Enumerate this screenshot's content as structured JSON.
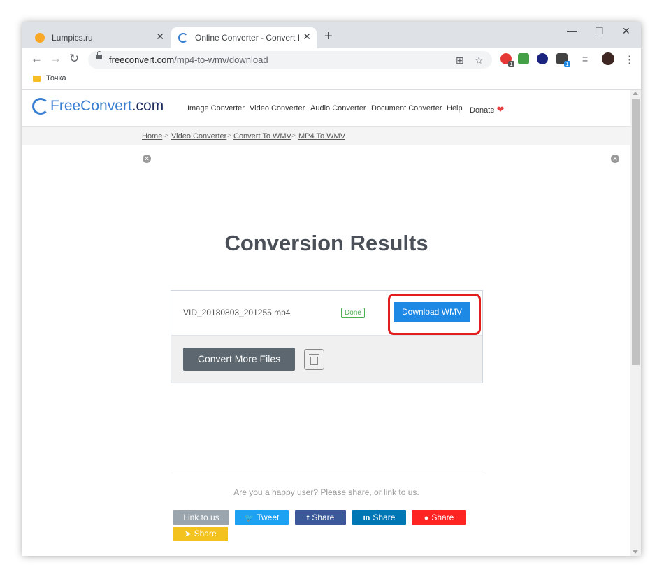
{
  "browser": {
    "tabs": [
      {
        "title": "Lumpics.ru",
        "favicon": "lumpics-favicon",
        "active": false
      },
      {
        "title": "Online Converter - Convert Imag",
        "favicon": "freeconvert-favicon",
        "active": true
      }
    ],
    "new_tab": "+",
    "window_controls": {
      "minimize": "—",
      "maximize": "☐",
      "close": "✕"
    },
    "url_host": "freeconvert.com",
    "url_path": "/mp4-to-wmv/download",
    "bookmark": "Точка"
  },
  "site": {
    "logo_text": "FreeConvert",
    "logo_suffix": ".com",
    "nav": [
      "Image Converter",
      "Video Converter",
      "Audio Converter",
      "Document Converter",
      "Help",
      "Donate"
    ],
    "breadcrumb": [
      "Home",
      "Video Converter",
      "Convert To WMV",
      "MP4 To WMV"
    ],
    "breadcrumb_sep": ">"
  },
  "main": {
    "heading": "Conversion Results",
    "file_name": "VID_20180803_201255.mp4",
    "status": "Done",
    "download_label": "Download WMV",
    "convert_more_label": "Convert More Files",
    "share_prompt": "Are you a happy user? Please share, or link to us."
  },
  "share_buttons": [
    {
      "label": "Link to us",
      "icon": "",
      "color": "#9aa5ad"
    },
    {
      "label": "Tweet",
      "icon": "twitter-icon",
      "color": "#1da1f2"
    },
    {
      "label": "Share",
      "icon": "facebook-icon",
      "color": "#3b5998"
    },
    {
      "label": "Share",
      "icon": "linkedin-icon",
      "color": "#0077b5"
    },
    {
      "label": "Share",
      "icon": "reddit-icon",
      "color": "#ff2424"
    },
    {
      "label": "Share",
      "icon": "telegram-icon",
      "color": "#f4c21f"
    }
  ],
  "colors": {
    "accent": "#1e88e5",
    "highlight": "#e21d1d"
  }
}
